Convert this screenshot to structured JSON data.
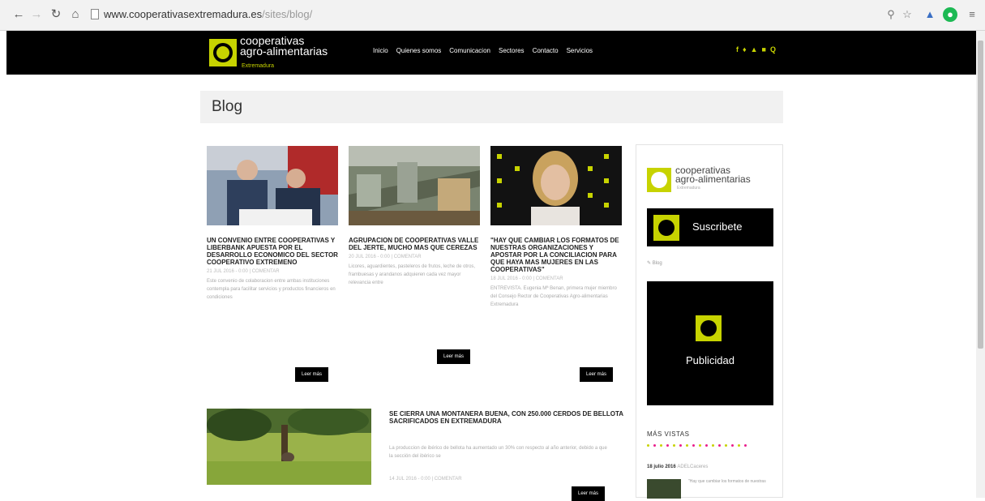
{
  "browser": {
    "url_domain": "www.cooperativasextremadura.es",
    "url_path": "/sites/blog/"
  },
  "header": {
    "logo_line1": "cooperativas",
    "logo_line2": "agro-alimentarias",
    "logo_sub": "Extremadura",
    "menu": [
      "Inicio",
      "Quienes somos",
      "Comunicacion",
      "Sectores",
      "Contacto",
      "Servicios"
    ],
    "social": [
      "f",
      "♦",
      "▲",
      "■",
      "Q"
    ]
  },
  "page": {
    "title": "Blog"
  },
  "posts": [
    {
      "title": "UN CONVENIO ENTRE COOPERATIVAS Y LIBERBANK APUESTA POR EL DESARROLLO ECONOMICO DEL SECTOR COOPERATIVO EXTREMENO",
      "date": "21 JUL 2016 - 0:00 | COMENTAR",
      "excerpt": "Este convenio de colaboracion entre ambas instituciones contempla para facilitar servicios y productos financieros en condiciones",
      "read_more": "Leer más"
    },
    {
      "title": "AGRUPACION DE COOPERATIVAS VALLE DEL JERTE, MUCHO MAS QUE CEREZAS",
      "date": "20 JUL 2016 - 0:00 | COMENTAR",
      "excerpt": "Licores, aguardientes, pasteleros de frutos, leche de otros, frambuesas y arandanos adquieren cada vez mayor relevancia entre",
      "read_more": "Leer más"
    },
    {
      "title": "\"HAY QUE CAMBIAR LOS FORMATOS DE NUESTRAS ORGANIZACIONES Y APOSTAR POR LA CONCILIACION PARA QUE HAYA MAS MUJERES EN LAS COOPERATIVAS\"",
      "date": "18 JUL 2016 - 0:00 | COMENTAR",
      "excerpt": "ENTREVISTA. Eugenia Mª Benan, primera mujer miembro del Consejo Rector de Cooperativas Agro-alimentarias Extremadura",
      "read_more": "Leer más"
    },
    {
      "title": "SE CIERRA UNA MONTANERA BUENA, CON 250.000 CERDOS DE BELLOTA SACRIFICADOS EN EXTREMADURA",
      "excerpt": "La produccion de ibérico de bellota ha aumentado un 30% con respecto al año anterior, debido a que la sección del ibérico se",
      "date": "14 JUL 2016 - 0:00 | COMENTAR",
      "read_more": "Leer más"
    }
  ],
  "sidebar": {
    "logo_line1": "cooperativas",
    "logo_line2": "agro-alimentarias",
    "logo_sub": "Extremadura",
    "subscribe_label": "Suscribete",
    "blog_label": "Blog",
    "publicidad_label": "Publicidad",
    "mas_vistas": "MÁS VISTAS",
    "latest_date": "18 julio 2016",
    "latest_author": "ADELCaceres",
    "latest_excerpt": "\"Hay que cambiar los formatos de nuestras"
  },
  "colors": {
    "brand_green": "#c7d300",
    "header_bg": "#000000"
  }
}
